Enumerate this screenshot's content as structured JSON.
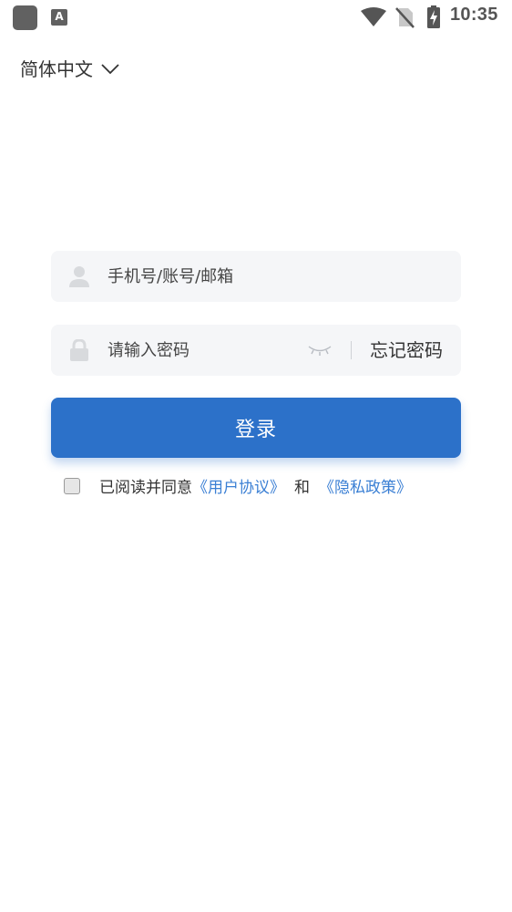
{
  "status_bar": {
    "notification_icon": "A",
    "time": "10:35"
  },
  "language": {
    "label": "简体中文"
  },
  "login": {
    "account_placeholder": "手机号/账号/邮箱",
    "password_placeholder": "请输入密码",
    "forgot_password": "忘记密码",
    "submit": "登录"
  },
  "agreement": {
    "prefix": "已阅读并同意",
    "user_agreement": "《用户协议》",
    "and": "和",
    "privacy_policy": "《隐私政策》",
    "checked": false
  },
  "colors": {
    "primary": "#2c71c9",
    "link": "#3a7fd4",
    "field_bg": "#f5f6f8"
  },
  "icons": {
    "language": "chevron-down-icon",
    "account": "user-icon",
    "password": "lock-icon",
    "visibility": "eye-closed-icon"
  }
}
